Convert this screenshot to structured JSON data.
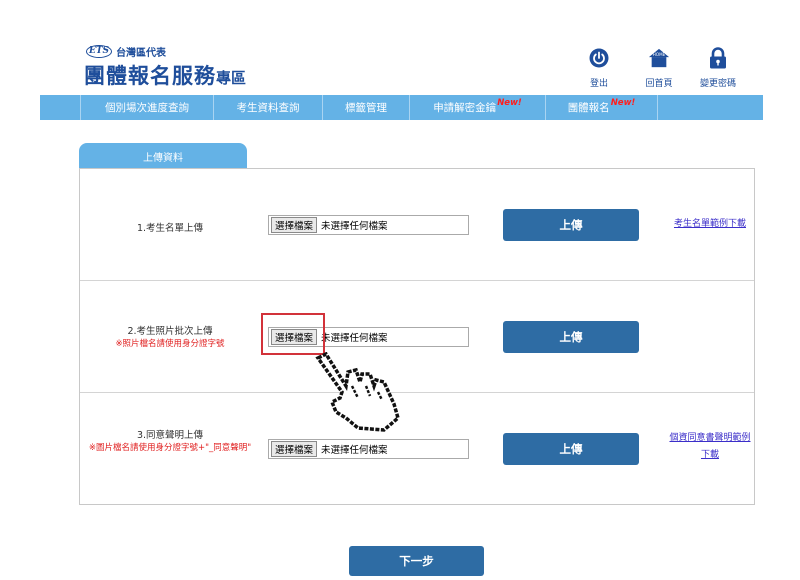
{
  "header": {
    "brand_small": "台灣區代表",
    "brand_badge": "ETS",
    "brand_main": "團體報名服務",
    "brand_main_sub": "專區",
    "links": {
      "logout": "登出",
      "home": "回首頁",
      "home_icon_text": "HOME",
      "change_password": "變更密碼"
    }
  },
  "nav": {
    "items": [
      {
        "label": "個別場次進度查詢",
        "new": ""
      },
      {
        "label": "考生資料查詢",
        "new": ""
      },
      {
        "label": "標籤管理",
        "new": ""
      },
      {
        "label": "申請解密金鑰",
        "new": "New!"
      },
      {
        "label": "團體報名",
        "new": "New!"
      }
    ]
  },
  "tab": {
    "label": "上傳資料"
  },
  "form": {
    "file_button": "選擇檔案",
    "file_status": "未選擇任何檔案",
    "upload_label": "上傳",
    "rows": [
      {
        "label": "1.考生名單上傳",
        "note": "",
        "link": "考生名單範例下載"
      },
      {
        "label": "2.考生照片批次上傳",
        "note": "※照片檔名請使用身分證字號",
        "link": ""
      },
      {
        "label": "3.同意聲明上傳",
        "note": "※圖片檔名請使用身分證字號+\"_同意聲明\"",
        "link": "個資同意書聲明範例下載"
      }
    ]
  },
  "footer": {
    "next_label": "下一步"
  },
  "colors": {
    "nav": "#64b2e6",
    "button": "#2e6ca4",
    "brand": "#1f4e9b",
    "alert": "#e02020",
    "highlight": "#d2323a"
  }
}
